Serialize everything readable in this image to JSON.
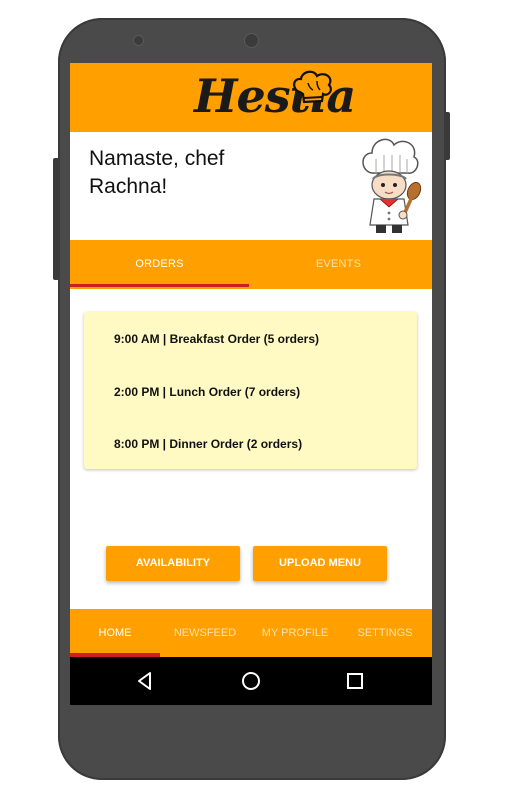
{
  "app": {
    "logo_text": "Hestia"
  },
  "greeting": {
    "line1": "Namaste, chef",
    "line2": "Rachna!"
  },
  "tabs": [
    {
      "label": "ORDERS",
      "active": true
    },
    {
      "label": "EVENTS",
      "active": false
    }
  ],
  "orders": [
    {
      "text": "9:00 AM | Breakfast Order (5 orders)"
    },
    {
      "text": "2:00 PM | Lunch Order (7 orders)"
    },
    {
      "text": "8:00 PM | Dinner Order (2 orders)"
    }
  ],
  "actions": {
    "availability": "AVAILABILITY",
    "upload_menu": "UPLOAD MENU"
  },
  "bottom_nav": [
    {
      "label": "HOME",
      "active": true
    },
    {
      "label": "NEWSFEED",
      "active": false
    },
    {
      "label": "MY PROFILE",
      "active": false
    },
    {
      "label": "SETTINGS",
      "active": false
    }
  ],
  "system_nav": {
    "back": "back-icon",
    "home": "home-circle-icon",
    "recents": "recents-square-icon"
  },
  "colors": {
    "primary": "#ffa000",
    "indicator": "#d01e1e",
    "card": "#fffac3"
  }
}
